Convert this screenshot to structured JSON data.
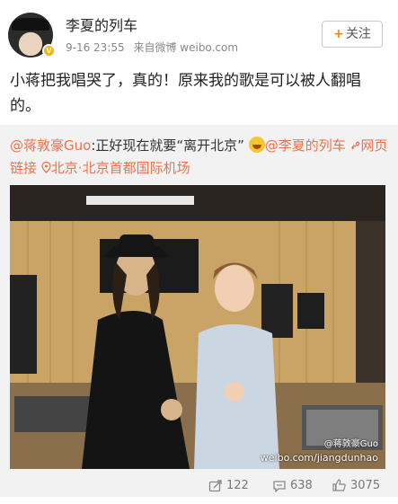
{
  "post": {
    "author": "李夏的列车",
    "time": "9-16 23:55",
    "source": "来自微博 weibo.com",
    "follow_label": "关注",
    "text": "小蒋把我唱哭了，真的！原来我的歌是可以被人翻唱的。"
  },
  "repost": {
    "mention_author": "@蒋敦豪Guo",
    "text_before_emoji": ":正好现在就要“离开北京”",
    "mention_target": "@李夏的列车",
    "link_label": "网页链接",
    "location": "北京·北京首都国际机场",
    "photo_watermark_name": "@蒋敦豪Guo",
    "photo_watermark_url": "weibo.com/jiangdunhao"
  },
  "stats": {
    "reposts": "122",
    "comments": "638",
    "likes": "3075"
  }
}
